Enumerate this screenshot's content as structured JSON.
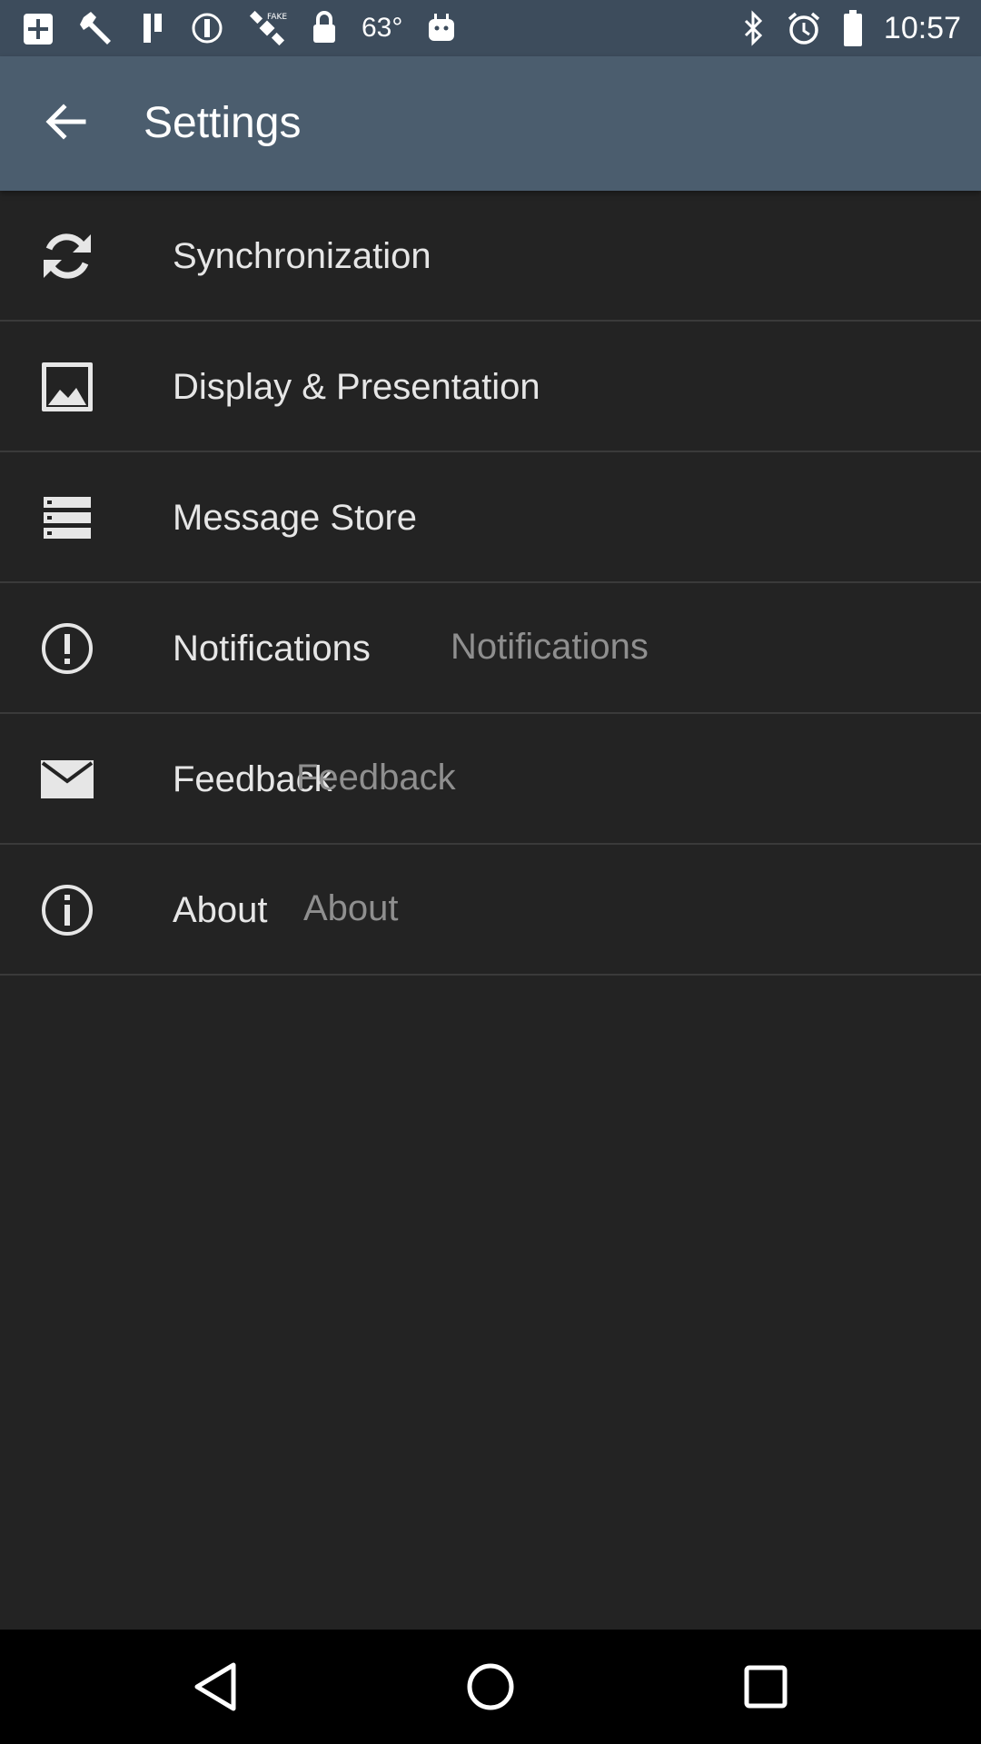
{
  "status_bar": {
    "temperature": "63°",
    "time": "10:57",
    "left_icons": [
      "plus-box-icon",
      "wrench-icon",
      "pause-icon",
      "signal-disabled-icon",
      "fake-gps-satellite-icon",
      "lock-icon",
      "android-icon"
    ],
    "right_icons": [
      "bluetooth-icon",
      "alarm-icon",
      "battery-icon"
    ]
  },
  "app_bar": {
    "title": "Settings",
    "back_icon": "arrow-back-icon",
    "color": "#4b5d6e"
  },
  "settings": {
    "items": [
      {
        "label": "Synchronization",
        "icon": "sync-icon",
        "summary": ""
      },
      {
        "label": "Display & Presentation",
        "icon": "image-icon",
        "summary": ""
      },
      {
        "label": "Message Store",
        "icon": "storage-icon",
        "summary": ""
      },
      {
        "label": "Notifications",
        "icon": "alert-circle-icon",
        "summary": "Notifications"
      },
      {
        "label": "Feedback",
        "icon": "mail-icon",
        "summary": "Feedback"
      },
      {
        "label": "About",
        "icon": "info-icon",
        "summary": "About"
      }
    ]
  },
  "nav_bar": {
    "buttons": [
      "back-triangle-icon",
      "home-circle-icon",
      "recents-square-icon"
    ]
  }
}
